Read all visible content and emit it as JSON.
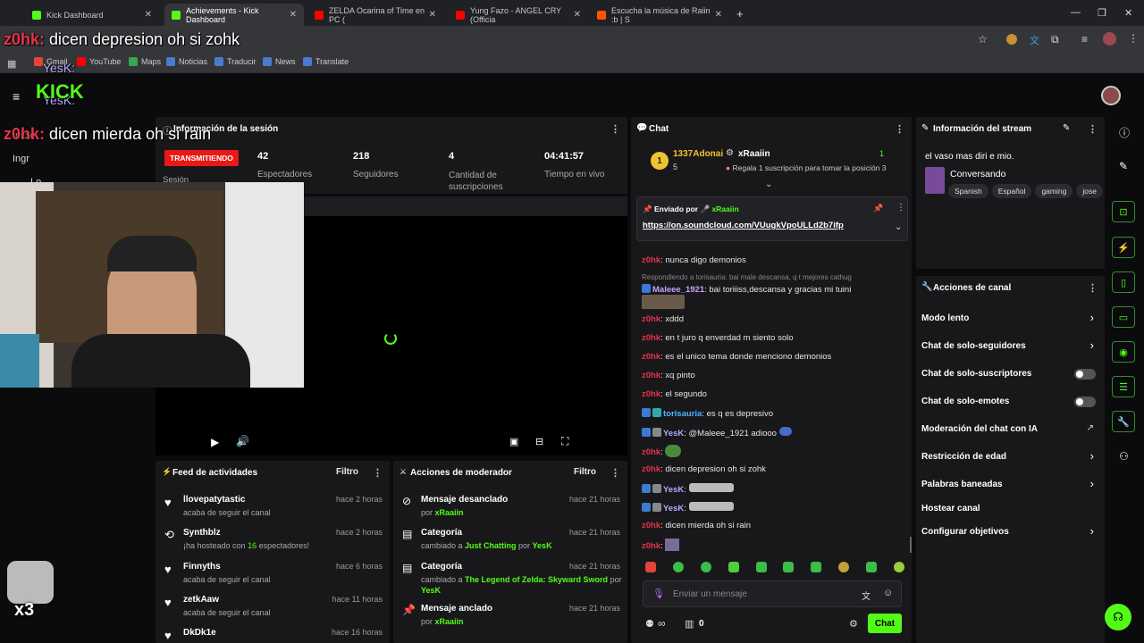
{
  "browser": {
    "tabs": [
      {
        "label": "Kick Dashboard",
        "active": false,
        "color": "#53fc18"
      },
      {
        "label": "Achievements - Kick Dashboard",
        "active": true,
        "color": "#53fc18"
      },
      {
        "label": "ZELDA Ocarina of Time en PC (",
        "active": false,
        "color": "#ff0000"
      },
      {
        "label": "Yung Fazo - ANGEL CRY (Officia",
        "active": false,
        "color": "#ff0000"
      },
      {
        "label": "Escucha la música de Raiin :b | S",
        "active": false,
        "color": "#ff5500"
      }
    ],
    "bookmarks": [
      "Gmail",
      "YouTube",
      "Maps",
      "Noticias",
      "Traducir",
      "News",
      "Translate"
    ]
  },
  "overlay": {
    "top_user": "z0hk:",
    "top_msg": "dicen depresion oh si zohk",
    "second_user": "z0hk:",
    "second_msg": "dicen mierda oh si rain",
    "yesk1": "YesK:",
    "yesk2": "YesK:",
    "kick_logo": "KICK",
    "x3": "x3",
    "inicio": "Inicio",
    "ingr": "Ingr",
    "lo": "Lo"
  },
  "session": {
    "title": "Información de la sesión",
    "live_badge": "TRANSMITIENDO",
    "sesion_label": "Sesión",
    "stats": [
      {
        "value": "42",
        "label": "Espectadores"
      },
      {
        "value": "218",
        "label": "Seguidores"
      },
      {
        "value": "4",
        "label": "Cantidad de suscripciones"
      },
      {
        "value": "04:41:57",
        "label": "Tiempo en vivo"
      }
    ]
  },
  "activity": {
    "title": "Feed de actividades",
    "filter": "Filtro",
    "items": [
      {
        "name": "llovepatytastic",
        "sub": "acaba de seguir el canal",
        "time": "hace 2 horas",
        "icon": "heart-icon"
      },
      {
        "name": "Synthblz",
        "sub_pre": "¡ha hosteado con ",
        "sub_num": "16",
        "sub_post": " espectadores!",
        "time": "hace 2 horas",
        "icon": "host-icon"
      },
      {
        "name": "Finnyths",
        "sub": "acaba de seguir el canal",
        "time": "hace 6 horas",
        "icon": "heart-icon"
      },
      {
        "name": "zetkAaw",
        "sub": "acaba de seguir el canal",
        "time": "hace 11 horas",
        "icon": "heart-icon"
      },
      {
        "name": "DkDk1e",
        "sub": "",
        "time": "hace 16 horas",
        "icon": "heart-icon"
      }
    ]
  },
  "moderator": {
    "title": "Acciones de moderador",
    "filter": "Filtro",
    "items": [
      {
        "name": "Mensaje desanclado",
        "l1_pre": "por ",
        "l1_hl": "xRaaiin",
        "time": "hace 21 horas"
      },
      {
        "name": "Categoría",
        "l1_pre": "cambiado a ",
        "l1_hl": "Just Chatting",
        "l1_mid": " por ",
        "l1_hl2": "YesK",
        "time": "hace 21 horas"
      },
      {
        "name": "Categoría",
        "l1_pre": "cambiado a ",
        "l1_hl": "The Legend of Zelda: Skyward Sword",
        "l1_mid": " por",
        "l2": "YesK",
        "time": "hace 21 horas"
      },
      {
        "name": "Mensaje anclado",
        "l1_pre": "por ",
        "l1_hl": "xRaaiin",
        "time": "hace 21 horas"
      }
    ]
  },
  "chat": {
    "title": "Chat",
    "top_user": "1337Adonai",
    "top_user_count": "5",
    "top_rank": "1",
    "leader": "xRaaiin",
    "leader_count": "1",
    "gift_text": "Regala 1 suscripción para tomar la posición 3",
    "pinned_by": "Enviado por",
    "pinned_user": "xRaaiin",
    "pinned_link": "https://on.soundcloud.com/VUugkVpoULLd2b7ifp",
    "reply_hint": "Respondiendo a torisauria: bai male descansa, q t mejores cathug",
    "messages": [
      {
        "user": "z0hk",
        "cls": "u-zohk",
        "text": ": nunca digo demonios"
      },
      {
        "user": "Maleee_1921",
        "cls": "u-mal",
        "text": ": bai toriiiss,descansa y gracias mi tuini"
      },
      {
        "user": "z0hk",
        "cls": "u-zohk",
        "text": ": xddd"
      },
      {
        "user": "z0hk",
        "cls": "u-zohk",
        "text": ": en t juro q enverdad m siento solo"
      },
      {
        "user": "z0hk",
        "cls": "u-zohk",
        "text": ": es el unico tema donde menciono demonios"
      },
      {
        "user": "z0hk",
        "cls": "u-zohk",
        "text": ": xq pinto"
      },
      {
        "user": "z0hk",
        "cls": "u-zohk",
        "text": ": el segundo"
      },
      {
        "user": "torisauria",
        "cls": "u-tor",
        "text": ": es q es depresivo"
      },
      {
        "user": "YesK",
        "cls": "u-yesk",
        "text": ": @Maleee_1921 adiooo"
      },
      {
        "user": "z0hk",
        "cls": "u-zohk",
        "text": ":"
      },
      {
        "user": "z0hk",
        "cls": "u-zohk",
        "text": ": dicen depresion oh si zohk"
      },
      {
        "user": "YesK",
        "cls": "u-yesk",
        "text": ":"
      },
      {
        "user": "YesK",
        "cls": "u-yesk",
        "text": ":"
      },
      {
        "user": "z0hk",
        "cls": "u-zohk",
        "text": ": dicen mierda oh si rain"
      },
      {
        "user": "z0hk",
        "cls": "u-zohk",
        "text": ":"
      }
    ],
    "input_placeholder": "Enviar un mensaje",
    "viewers_inf": "∞",
    "cart_count": "0",
    "send_label": "Chat"
  },
  "stream_info": {
    "title": "Información del stream",
    "stream_title": "el vaso mas diri e mio.",
    "category": "Conversando",
    "tags": [
      "Spanish",
      "Español",
      "gaming",
      "jose"
    ]
  },
  "channel_actions": {
    "title": "Acciones de canal",
    "items": [
      {
        "label": "Modo lento",
        "kind": "chev"
      },
      {
        "label": "Chat de solo-seguidores",
        "kind": "chev"
      },
      {
        "label": "Chat de solo-suscriptores",
        "kind": "switch"
      },
      {
        "label": "Chat de solo-emotes",
        "kind": "switch"
      },
      {
        "label": "Moderación del chat con IA",
        "kind": "ext"
      },
      {
        "label": "Restricción de edad",
        "kind": "chev"
      },
      {
        "label": "Palabras baneadas",
        "kind": "chev"
      },
      {
        "label": "Hostear canal",
        "kind": "none"
      },
      {
        "label": "Configurar objetivos",
        "kind": "chev"
      }
    ]
  },
  "colors": {
    "accent": "#53fc18",
    "live": "#e91916",
    "panel": "#18181b"
  }
}
